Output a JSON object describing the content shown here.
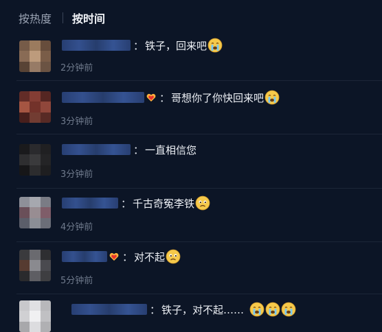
{
  "sort": {
    "hot_label": "按热度",
    "time_label": "按时间"
  },
  "comments": [
    {
      "text": "铁子，回来吧",
      "time": "2分钟前",
      "emojis": [
        "crying-emoji"
      ]
    },
    {
      "text": "哥想你了你快回来吧",
      "time": "3分钟前",
      "emojis": [
        "crying-emoji"
      ],
      "badge": "heart-hands-icon"
    },
    {
      "text": "一直相信您",
      "time": "3分钟前",
      "emojis": []
    },
    {
      "text": "千古奇冤李铁",
      "time": "4分钟前",
      "emojis": [
        "sad-emoji"
      ]
    },
    {
      "text": "对不起",
      "time": "5分钟前",
      "emojis": [
        "sad-emoji"
      ],
      "badge": "heart-hands-icon"
    },
    {
      "text": "铁子，对不起……",
      "time": "",
      "emojis": [
        "crying-emoji",
        "crying-emoji",
        "crying-emoji"
      ]
    }
  ],
  "colors": {
    "background": "#0c1526",
    "time_text": "#6f7a8c",
    "name_blur": "#34508f"
  }
}
